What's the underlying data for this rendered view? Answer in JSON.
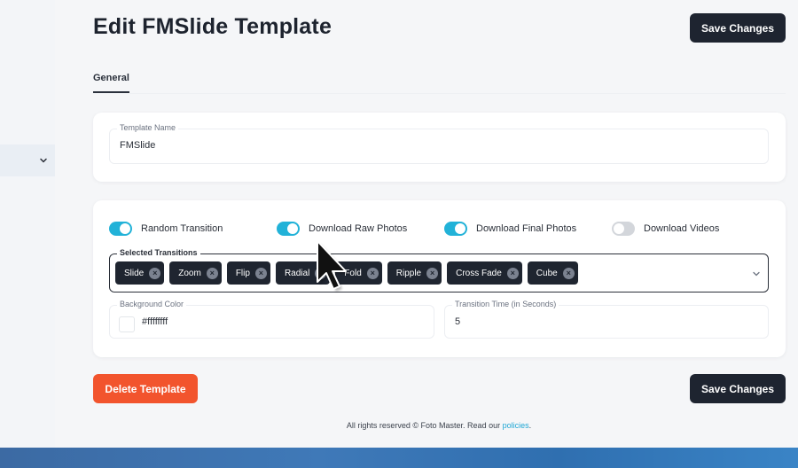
{
  "page": {
    "title": "Edit FMSlide Template",
    "save_label": "Save Changes",
    "delete_label": "Delete Template"
  },
  "tabs": [
    {
      "label": "General",
      "active": true
    }
  ],
  "template_name": {
    "label": "Template Name",
    "value": "FMSlide"
  },
  "toggles": [
    {
      "label": "Random Transition",
      "on": true
    },
    {
      "label": "Download Raw Photos",
      "on": true
    },
    {
      "label": "Download Final Photos",
      "on": true
    },
    {
      "label": "Download Videos",
      "on": false
    }
  ],
  "selected_transitions": {
    "label": "Selected Transitions",
    "chips": [
      "Slide",
      "Zoom",
      "Flip",
      "Radial",
      "Fold",
      "Ripple",
      "Cross Fade",
      "Cube"
    ]
  },
  "background_color": {
    "label": "Background Color",
    "value": "#ffffffff"
  },
  "transition_time": {
    "label": "Transition Time (in Seconds)",
    "value": "5"
  },
  "footer": {
    "text": "All rights reserved © Foto Master. Read our ",
    "link": "policies",
    "end": "."
  },
  "colors": {
    "accent": "#22b2d8",
    "dark": "#1e2430",
    "danger": "#f2542d"
  }
}
